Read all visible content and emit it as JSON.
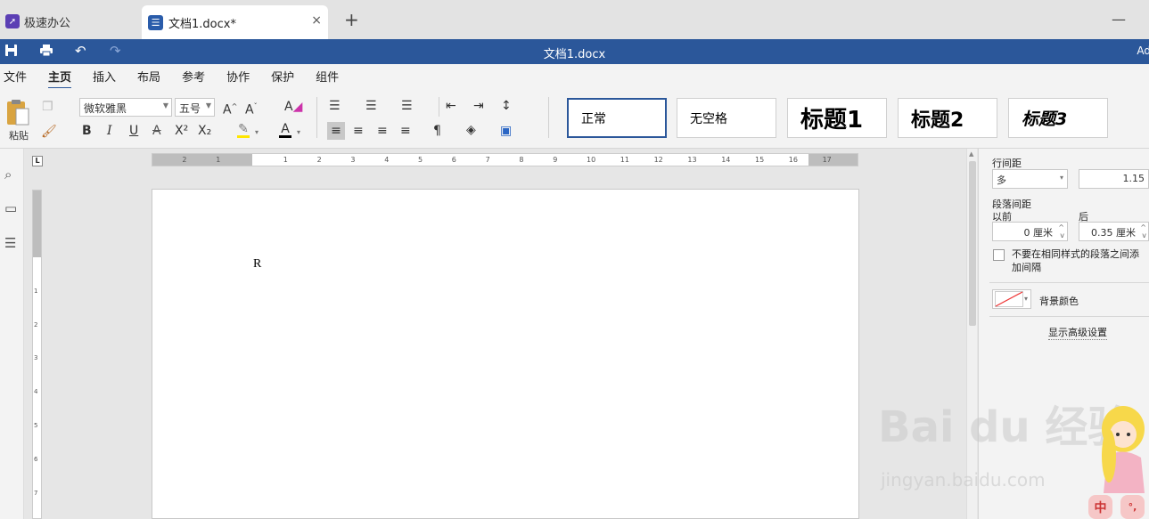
{
  "tabs": {
    "app_tab": {
      "label": "极速办公",
      "icon": "rocket-icon"
    },
    "doc_tab": {
      "label": "文档1.docx*",
      "icon": "document-icon",
      "close": "×"
    },
    "new_tab": "+",
    "minimize": "—"
  },
  "titlebar": {
    "title": "文档1.docx",
    "account": "Ad",
    "accent": "#2b579a"
  },
  "menu": [
    "文件",
    "主页",
    "插入",
    "布局",
    "参考",
    "协作",
    "保护",
    "组件"
  ],
  "menu_active": "主页",
  "ribbon": {
    "paste_label": "粘贴",
    "font_name": "微软雅黑",
    "font_size": "五号",
    "bold": "B",
    "italic": "I",
    "underline": "U",
    "strike": "A",
    "superscript": "X²",
    "subscript": "X₂",
    "font_color": "A",
    "styles": [
      "正常",
      "无空格",
      "标题1",
      "标题2",
      "标题3"
    ]
  },
  "ruler": {
    "h_numbers": [
      "2",
      "1",
      "1",
      "2",
      "3",
      "4",
      "5",
      "6",
      "7",
      "8",
      "9",
      "10",
      "11",
      "12",
      "13",
      "14",
      "15",
      "16",
      "17"
    ],
    "v_numbers": [
      "1",
      "2",
      "3",
      "4",
      "5",
      "6",
      "7"
    ],
    "corner": "L"
  },
  "document": {
    "text": "R"
  },
  "panel": {
    "line_spacing_label": "行间距",
    "line_spacing_mode": "多",
    "line_spacing_value": "1.15",
    "para_spacing_label": "段落间距",
    "before_label": "以前",
    "after_label": "后",
    "before_value": "0 厘米",
    "after_value": "0.35 厘米",
    "same_style_checkbox": "不要在相同样式的段落之间添加间隔",
    "background_color_label": "背景颜色",
    "advanced_link": "显示高级设置"
  },
  "watermark": {
    "brand": "Bai du 经验",
    "url": "jingyan.baidu.com"
  },
  "ime": {
    "lang": "中",
    "punct": "°,"
  }
}
